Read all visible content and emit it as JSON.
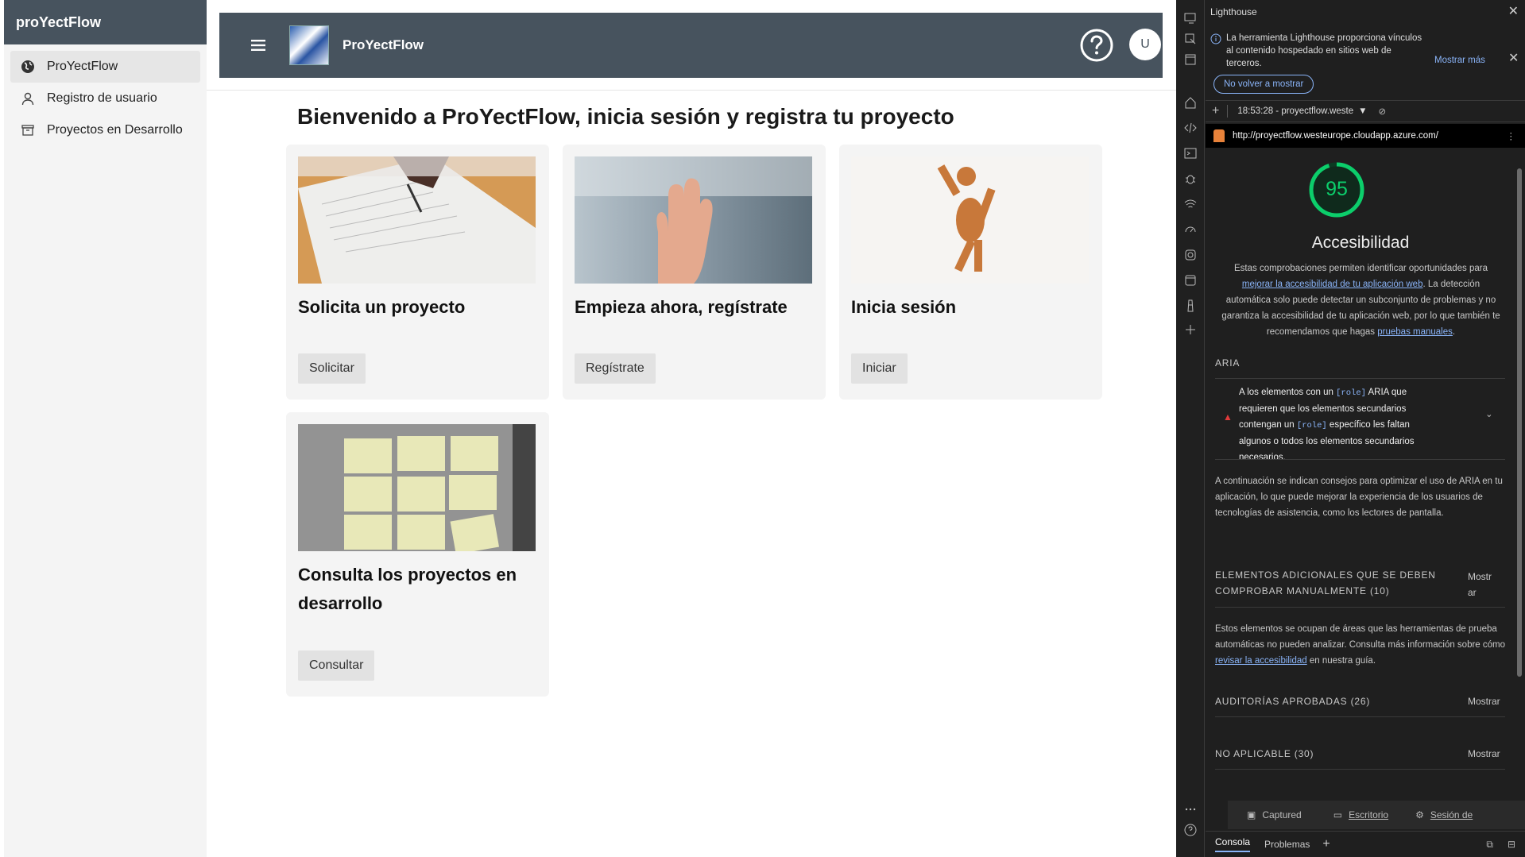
{
  "sidebar": {
    "brand": "proYectFlow",
    "items": [
      {
        "label": "ProYectFlow",
        "icon": "globe-icon",
        "active": true
      },
      {
        "label": "Registro de usuario",
        "icon": "user-icon",
        "active": false
      },
      {
        "label": "Proyectos en Desarrollo",
        "icon": "archive-icon",
        "active": false
      }
    ]
  },
  "header": {
    "app_title": "ProYectFlow",
    "avatar_initial": "U"
  },
  "main": {
    "heading": "Bienvenido a ProYectFlow, inicia sesión y registra tu proyecto",
    "cards": [
      {
        "title": "Solicita un proyecto",
        "button": "Solicitar",
        "image": "hand-signing-document"
      },
      {
        "title": "Empieza ahora, regístrate",
        "button": "Regístrate",
        "image": "raised-hand-photo"
      },
      {
        "title": "Inicia sesión",
        "button": "Iniciar",
        "image": "wooden-mannequin-photo"
      },
      {
        "title": "Consulta los proyectos en desarrollo",
        "button": "Consultar",
        "image": "sticky-notes-photo"
      }
    ]
  },
  "devtools": {
    "panel_title": "Lighthouse",
    "notice": "La herramienta Lighthouse proporciona vínculos al contenido hospedado en sitios web de terceros.",
    "notice_more": "Mostrar más",
    "dont_show": "No volver a mostrar",
    "report_time": "18:53:28 - proyectflow.weste",
    "url": "http://proyectflow.westeurope.cloudapp.azure.com/",
    "score": "95",
    "score_value": 95,
    "category": "Accesibilidad",
    "description_1": "Estas comprobaciones permiten identificar oportunidades para",
    "description_link": "mejorar la accesibilidad de tu aplicación web",
    "description_2": ". La detección automática solo puede detectar un subconjunto de problemas y no garantiza la accesibilidad de tu aplicación web, por lo que también te recomendamos que hagas",
    "description_link2": "pruebas manuales",
    "aria_head": "ARIA",
    "aria_audit_1": "A los elementos con un",
    "aria_audit_code": "[role]",
    "aria_audit_2": "ARIA que requieren que los elementos secundarios contengan un",
    "aria_audit_3": "específico les faltan algunos o todos los elementos secundarios necesarios.",
    "aria_tip": "A continuación se indican consejos para optimizar el uso de ARIA en tu aplicación, lo que puede mejorar la experiencia de los usuarios de tecnologías de asistencia, como los lectores de pantalla.",
    "manual_head": "ELEMENTOS ADICIONALES QUE SE DEBEN COMPROBAR MANUALMENTE (10)",
    "manual_more": "Mostrar",
    "manual_desc_1": "Estos elementos se ocupan de áreas que las herramientas de prueba automáticas no pueden analizar. Consulta más información sobre cómo",
    "manual_desc_link": "revisar la accesibilidad",
    "manual_desc_2": "en nuestra guía.",
    "passed_head": "AUDITORÍAS APROBADAS (26)",
    "passed_more": "Mostrar",
    "na_head": "NO APLICABLE (30)",
    "na_more": "Mostrar",
    "drawer": [
      "Captured",
      "Escritorio",
      "Sesión de"
    ],
    "bottom_tabs": [
      "Consola",
      "Problemas"
    ],
    "colors": {
      "score_green": "#0cce6b",
      "link": "#8ab4f8",
      "fail_red": "#e23b3b"
    }
  }
}
